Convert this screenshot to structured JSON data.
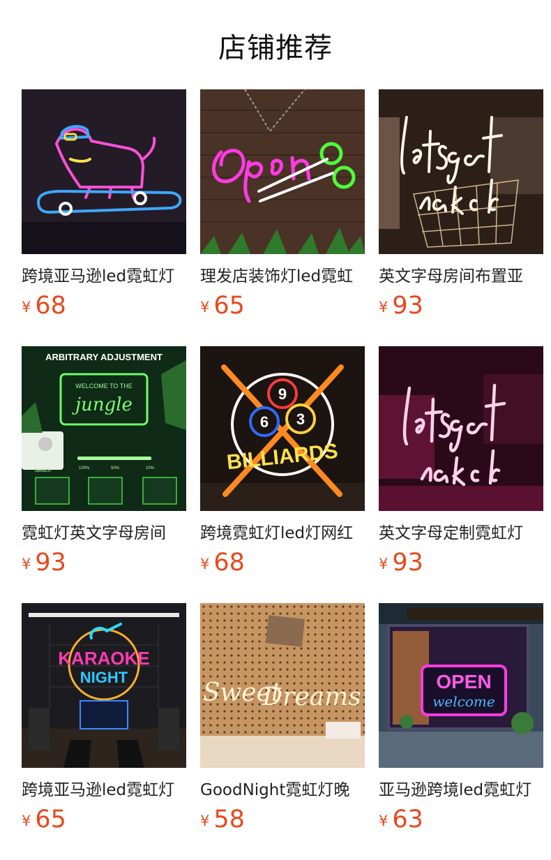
{
  "section_title": "店铺推荐",
  "products": [
    {
      "name": "跨境亚马逊led霓虹灯",
      "currency": "¥",
      "price": "68",
      "image": "neon-dog-skateboard"
    },
    {
      "name": "理发店装饰灯led霓虹",
      "currency": "¥",
      "price": "65",
      "image": "neon-open-scissors"
    },
    {
      "name": "英文字母房间布置亚",
      "currency": "¥",
      "price": "93",
      "image": "neon-lets-get-naked-basket"
    },
    {
      "name": "霓虹灯英文字母房间",
      "currency": "¥",
      "price": "93",
      "image": "neon-welcome-to-the-jungle",
      "image_text": {
        "banner": "ARBITRARY ADJUSTMENT",
        "line1": "WELCOME TO THE",
        "line2": "jungle",
        "switch": "Switch",
        "p1": "100%",
        "p2": "50%",
        "p3": "10%"
      }
    },
    {
      "name": "跨境霓虹灯led灯网红",
      "currency": "¥",
      "price": "68",
      "image": "neon-billiards",
      "image_text": {
        "word": "BILLIARDS",
        "b1": "9",
        "b2": "6",
        "b3": "3"
      }
    },
    {
      "name": "英文字母定制霓虹灯",
      "currency": "¥",
      "price": "93",
      "image": "neon-lets-get-naked-pink"
    },
    {
      "name": "跨境亚马逊led霓虹灯",
      "currency": "¥",
      "price": "65",
      "image": "neon-karaoke-night",
      "image_text": {
        "line1": "KARAOKE",
        "line2": "NIGHT"
      }
    },
    {
      "name": "GoodNight霓虹灯晚",
      "currency": "¥",
      "price": "58",
      "image": "neon-sweet-dreams",
      "image_text": {
        "line1": "Sweet",
        "line2": "Dreams"
      }
    },
    {
      "name": "亚马逊跨境led霓虹灯",
      "currency": "¥",
      "price": "63",
      "image": "neon-open-welcome-shopfront",
      "image_text": {
        "line1": "OPEN",
        "line2": "welcome"
      }
    }
  ]
}
